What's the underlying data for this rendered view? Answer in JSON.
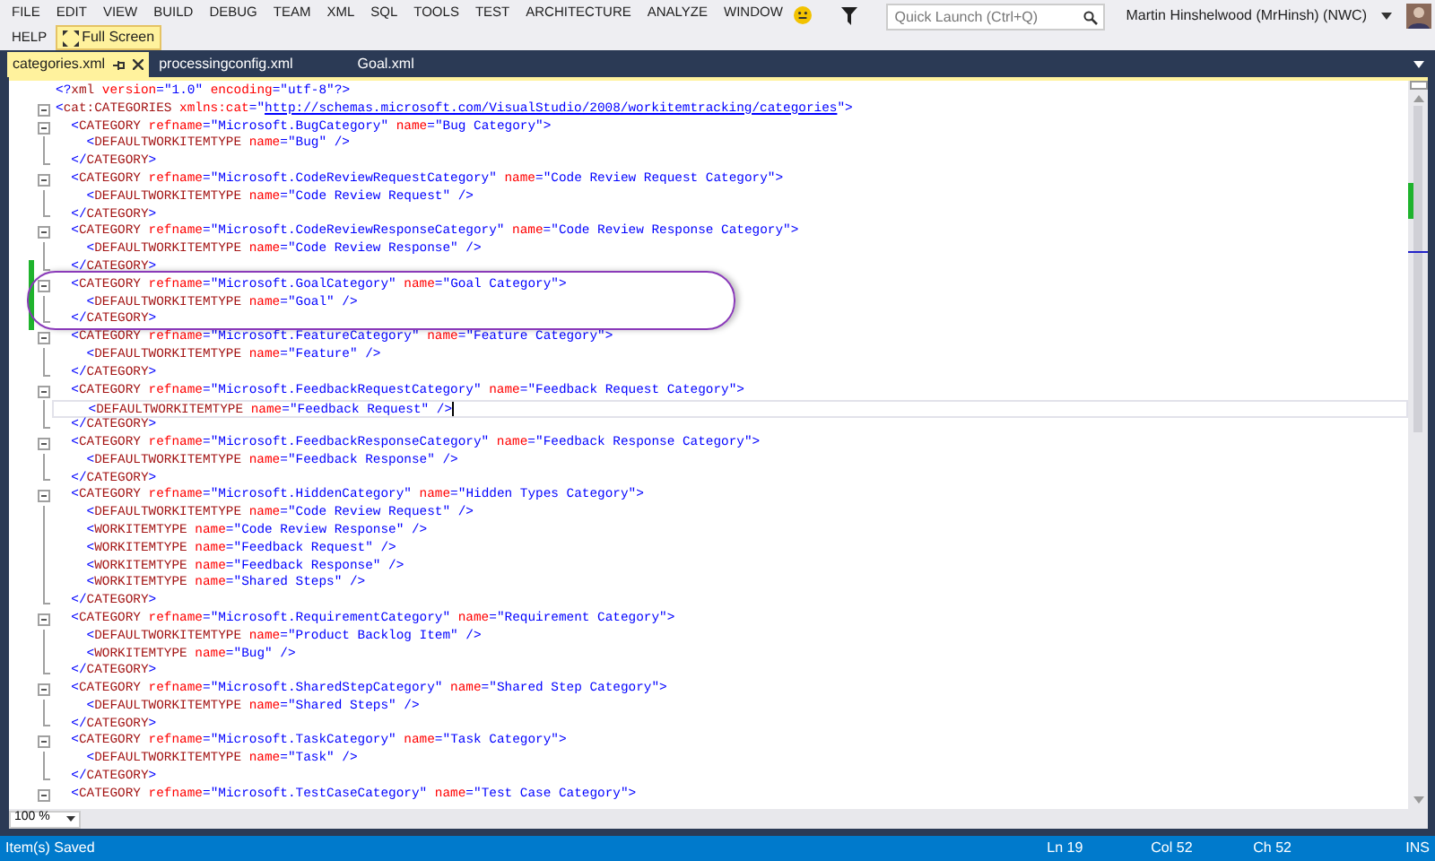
{
  "menu": [
    "FILE",
    "EDIT",
    "VIEW",
    "BUILD",
    "DEBUG",
    "TEAM",
    "XML",
    "SQL",
    "TOOLS",
    "TEST",
    "ARCHITECTURE",
    "ANALYZE",
    "WINDOW",
    "HELP"
  ],
  "full_screen": "Full Screen",
  "quick_launch": {
    "placeholder": "Quick Launch (Ctrl+Q)"
  },
  "user": "Martin Hinshelwood (MrHinsh) (NWC)",
  "tabs": [
    {
      "label": "categories.xml",
      "selected": true
    },
    {
      "label": "processingconfig.xml",
      "selected": false
    },
    {
      "label": "Goal.xml",
      "selected": false
    }
  ],
  "lines": [
    {
      "kind": "decl",
      "changed": false,
      "current": false,
      "t": [
        {
          "kind": "d",
          "text": "<?"
        },
        {
          "kind": "e",
          "text": "xml"
        },
        {
          "kind": "a",
          "text": " version"
        },
        {
          "kind": "d",
          "text": "="
        },
        {
          "kind": "v",
          "text": "\"1.0\""
        },
        {
          "kind": "a",
          "text": " encoding"
        },
        {
          "kind": "d",
          "text": "="
        },
        {
          "kind": "v",
          "text": "\"utf-8\""
        },
        {
          "kind": "d",
          "text": "?>"
        }
      ]
    },
    {
      "kind": "open",
      "changed": false,
      "current": false,
      "t": [
        {
          "kind": "d",
          "text": "<"
        },
        {
          "kind": "e",
          "text": "cat:CATEGORIES"
        },
        {
          "kind": "a",
          "text": " xmlns:cat"
        },
        {
          "kind": "d",
          "text": "="
        },
        {
          "kind": "v",
          "text": "\""
        },
        {
          "kind": "u",
          "text": "http://schemas.microsoft.com/VisualStudio/2008/workitemtracking/categories"
        },
        {
          "kind": "v",
          "text": "\""
        },
        {
          "kind": "d",
          "text": ">"
        }
      ]
    },
    {
      "kind": "open",
      "changed": false,
      "current": false,
      "t": [
        {
          "kind": "d",
          "text": "  <"
        },
        {
          "kind": "e",
          "text": "CATEGORY"
        },
        {
          "kind": "a",
          "text": " refname"
        },
        {
          "kind": "d",
          "text": "="
        },
        {
          "kind": "v",
          "text": "\"Microsoft.BugCategory\""
        },
        {
          "kind": "a",
          "text": " name"
        },
        {
          "kind": "d",
          "text": "="
        },
        {
          "kind": "v",
          "text": "\"Bug Category\""
        },
        {
          "kind": "d",
          "text": ">"
        }
      ]
    },
    {
      "kind": "child",
      "changed": false,
      "current": false,
      "t": [
        {
          "kind": "d",
          "text": "    <"
        },
        {
          "kind": "e",
          "text": "DEFAULTWORKITEMTYPE"
        },
        {
          "kind": "a",
          "text": " name"
        },
        {
          "kind": "d",
          "text": "="
        },
        {
          "kind": "v",
          "text": "\"Bug\""
        },
        {
          "kind": "d",
          "text": " />"
        }
      ]
    },
    {
      "kind": "close",
      "changed": false,
      "current": false,
      "t": [
        {
          "kind": "d",
          "text": "  </"
        },
        {
          "kind": "e",
          "text": "CATEGORY"
        },
        {
          "kind": "d",
          "text": ">"
        }
      ]
    },
    {
      "kind": "open",
      "changed": false,
      "current": false,
      "t": [
        {
          "kind": "d",
          "text": "  <"
        },
        {
          "kind": "e",
          "text": "CATEGORY"
        },
        {
          "kind": "a",
          "text": " refname"
        },
        {
          "kind": "d",
          "text": "="
        },
        {
          "kind": "v",
          "text": "\"Microsoft.CodeReviewRequestCategory\""
        },
        {
          "kind": "a",
          "text": " name"
        },
        {
          "kind": "d",
          "text": "="
        },
        {
          "kind": "v",
          "text": "\"Code Review Request Category\""
        },
        {
          "kind": "d",
          "text": ">"
        }
      ]
    },
    {
      "kind": "child",
      "changed": false,
      "current": false,
      "t": [
        {
          "kind": "d",
          "text": "    <"
        },
        {
          "kind": "e",
          "text": "DEFAULTWORKITEMTYPE"
        },
        {
          "kind": "a",
          "text": " name"
        },
        {
          "kind": "d",
          "text": "="
        },
        {
          "kind": "v",
          "text": "\"Code Review Request\""
        },
        {
          "kind": "d",
          "text": " />"
        }
      ]
    },
    {
      "kind": "close",
      "changed": false,
      "current": false,
      "t": [
        {
          "kind": "d",
          "text": "  </"
        },
        {
          "kind": "e",
          "text": "CATEGORY"
        },
        {
          "kind": "d",
          "text": ">"
        }
      ]
    },
    {
      "kind": "open",
      "changed": false,
      "current": false,
      "t": [
        {
          "kind": "d",
          "text": "  <"
        },
        {
          "kind": "e",
          "text": "CATEGORY"
        },
        {
          "kind": "a",
          "text": " refname"
        },
        {
          "kind": "d",
          "text": "="
        },
        {
          "kind": "v",
          "text": "\"Microsoft.CodeReviewResponseCategory\""
        },
        {
          "kind": "a",
          "text": " name"
        },
        {
          "kind": "d",
          "text": "="
        },
        {
          "kind": "v",
          "text": "\"Code Review Response Category\""
        },
        {
          "kind": "d",
          "text": ">"
        }
      ]
    },
    {
      "kind": "child",
      "changed": false,
      "current": false,
      "t": [
        {
          "kind": "d",
          "text": "    <"
        },
        {
          "kind": "e",
          "text": "DEFAULTWORKITEMTYPE"
        },
        {
          "kind": "a",
          "text": " name"
        },
        {
          "kind": "d",
          "text": "="
        },
        {
          "kind": "v",
          "text": "\"Code Review Response\""
        },
        {
          "kind": "d",
          "text": " />"
        }
      ]
    },
    {
      "kind": "close",
      "changed": true,
      "current": false,
      "t": [
        {
          "kind": "d",
          "text": "  </"
        },
        {
          "kind": "e",
          "text": "CATEGORY"
        },
        {
          "kind": "d",
          "text": ">"
        }
      ]
    },
    {
      "kind": "open",
      "changed": true,
      "current": false,
      "t": [
        {
          "kind": "d",
          "text": "  <"
        },
        {
          "kind": "e",
          "text": "CATEGORY"
        },
        {
          "kind": "a",
          "text": " refname"
        },
        {
          "kind": "d",
          "text": "="
        },
        {
          "kind": "v",
          "text": "\"Microsoft.GoalCategory\""
        },
        {
          "kind": "a",
          "text": " name"
        },
        {
          "kind": "d",
          "text": "="
        },
        {
          "kind": "v",
          "text": "\"Goal Category\""
        },
        {
          "kind": "d",
          "text": ">"
        }
      ]
    },
    {
      "kind": "child",
      "changed": true,
      "current": false,
      "t": [
        {
          "kind": "d",
          "text": "    <"
        },
        {
          "kind": "e",
          "text": "DEFAULTWORKITEMTYPE"
        },
        {
          "kind": "a",
          "text": " name"
        },
        {
          "kind": "d",
          "text": "="
        },
        {
          "kind": "v",
          "text": "\"Goal\""
        },
        {
          "kind": "d",
          "text": " />"
        }
      ]
    },
    {
      "kind": "close",
      "changed": true,
      "current": false,
      "t": [
        {
          "kind": "d",
          "text": "  </"
        },
        {
          "kind": "e",
          "text": "CATEGORY"
        },
        {
          "kind": "d",
          "text": ">"
        }
      ]
    },
    {
      "kind": "open",
      "changed": false,
      "current": false,
      "t": [
        {
          "kind": "d",
          "text": "  <"
        },
        {
          "kind": "e",
          "text": "CATEGORY"
        },
        {
          "kind": "a",
          "text": " refname"
        },
        {
          "kind": "d",
          "text": "="
        },
        {
          "kind": "v",
          "text": "\"Microsoft.FeatureCategory\""
        },
        {
          "kind": "a",
          "text": " name"
        },
        {
          "kind": "d",
          "text": "="
        },
        {
          "kind": "v",
          "text": "\"Feature Category\""
        },
        {
          "kind": "d",
          "text": ">"
        }
      ]
    },
    {
      "kind": "child",
      "changed": false,
      "current": false,
      "t": [
        {
          "kind": "d",
          "text": "    <"
        },
        {
          "kind": "e",
          "text": "DEFAULTWORKITEMTYPE"
        },
        {
          "kind": "a",
          "text": " name"
        },
        {
          "kind": "d",
          "text": "="
        },
        {
          "kind": "v",
          "text": "\"Feature\""
        },
        {
          "kind": "d",
          "text": " />"
        }
      ]
    },
    {
      "kind": "close",
      "changed": false,
      "current": false,
      "t": [
        {
          "kind": "d",
          "text": "  </"
        },
        {
          "kind": "e",
          "text": "CATEGORY"
        },
        {
          "kind": "d",
          "text": ">"
        }
      ]
    },
    {
      "kind": "open",
      "changed": false,
      "current": false,
      "t": [
        {
          "kind": "d",
          "text": "  <"
        },
        {
          "kind": "e",
          "text": "CATEGORY"
        },
        {
          "kind": "a",
          "text": " refname"
        },
        {
          "kind": "d",
          "text": "="
        },
        {
          "kind": "v",
          "text": "\"Microsoft.FeedbackRequestCategory\""
        },
        {
          "kind": "a",
          "text": " name"
        },
        {
          "kind": "d",
          "text": "="
        },
        {
          "kind": "v",
          "text": "\"Feedback Request Category\""
        },
        {
          "kind": "d",
          "text": ">"
        }
      ]
    },
    {
      "kind": "child",
      "changed": false,
      "current": true,
      "t": [
        {
          "kind": "d",
          "text": "    <"
        },
        {
          "kind": "e",
          "text": "DEFAULTWORKITEMTYPE"
        },
        {
          "kind": "a",
          "text": " name"
        },
        {
          "kind": "d",
          "text": "="
        },
        {
          "kind": "v",
          "text": "\"Feedback Request\""
        },
        {
          "kind": "d",
          "text": " />"
        }
      ]
    },
    {
      "kind": "close",
      "changed": false,
      "current": false,
      "t": [
        {
          "kind": "d",
          "text": "  </"
        },
        {
          "kind": "e",
          "text": "CATEGORY"
        },
        {
          "kind": "d",
          "text": ">"
        }
      ]
    },
    {
      "kind": "open",
      "changed": false,
      "current": false,
      "t": [
        {
          "kind": "d",
          "text": "  <"
        },
        {
          "kind": "e",
          "text": "CATEGORY"
        },
        {
          "kind": "a",
          "text": " refname"
        },
        {
          "kind": "d",
          "text": "="
        },
        {
          "kind": "v",
          "text": "\"Microsoft.FeedbackResponseCategory\""
        },
        {
          "kind": "a",
          "text": " name"
        },
        {
          "kind": "d",
          "text": "="
        },
        {
          "kind": "v",
          "text": "\"Feedback Response Category\""
        },
        {
          "kind": "d",
          "text": ">"
        }
      ]
    },
    {
      "kind": "child",
      "changed": false,
      "current": false,
      "t": [
        {
          "kind": "d",
          "text": "    <"
        },
        {
          "kind": "e",
          "text": "DEFAULTWORKITEMTYPE"
        },
        {
          "kind": "a",
          "text": " name"
        },
        {
          "kind": "d",
          "text": "="
        },
        {
          "kind": "v",
          "text": "\"Feedback Response\""
        },
        {
          "kind": "d",
          "text": " />"
        }
      ]
    },
    {
      "kind": "close",
      "changed": false,
      "current": false,
      "t": [
        {
          "kind": "d",
          "text": "  </"
        },
        {
          "kind": "e",
          "text": "CATEGORY"
        },
        {
          "kind": "d",
          "text": ">"
        }
      ]
    },
    {
      "kind": "open",
      "changed": false,
      "current": false,
      "t": [
        {
          "kind": "d",
          "text": "  <"
        },
        {
          "kind": "e",
          "text": "CATEGORY"
        },
        {
          "kind": "a",
          "text": " refname"
        },
        {
          "kind": "d",
          "text": "="
        },
        {
          "kind": "v",
          "text": "\"Microsoft.HiddenCategory\""
        },
        {
          "kind": "a",
          "text": " name"
        },
        {
          "kind": "d",
          "text": "="
        },
        {
          "kind": "v",
          "text": "\"Hidden Types Category\""
        },
        {
          "kind": "d",
          "text": ">"
        }
      ]
    },
    {
      "kind": "child",
      "changed": false,
      "current": false,
      "t": [
        {
          "kind": "d",
          "text": "    <"
        },
        {
          "kind": "e",
          "text": "DEFAULTWORKITEMTYPE"
        },
        {
          "kind": "a",
          "text": " name"
        },
        {
          "kind": "d",
          "text": "="
        },
        {
          "kind": "v",
          "text": "\"Code Review Request\""
        },
        {
          "kind": "d",
          "text": " />"
        }
      ]
    },
    {
      "kind": "child",
      "changed": false,
      "current": false,
      "t": [
        {
          "kind": "d",
          "text": "    <"
        },
        {
          "kind": "e",
          "text": "WORKITEMTYPE"
        },
        {
          "kind": "a",
          "text": " name"
        },
        {
          "kind": "d",
          "text": "="
        },
        {
          "kind": "v",
          "text": "\"Code Review Response\""
        },
        {
          "kind": "d",
          "text": " />"
        }
      ]
    },
    {
      "kind": "child",
      "changed": false,
      "current": false,
      "t": [
        {
          "kind": "d",
          "text": "    <"
        },
        {
          "kind": "e",
          "text": "WORKITEMTYPE"
        },
        {
          "kind": "a",
          "text": " name"
        },
        {
          "kind": "d",
          "text": "="
        },
        {
          "kind": "v",
          "text": "\"Feedback Request\""
        },
        {
          "kind": "d",
          "text": " />"
        }
      ]
    },
    {
      "kind": "child",
      "changed": false,
      "current": false,
      "t": [
        {
          "kind": "d",
          "text": "    <"
        },
        {
          "kind": "e",
          "text": "WORKITEMTYPE"
        },
        {
          "kind": "a",
          "text": " name"
        },
        {
          "kind": "d",
          "text": "="
        },
        {
          "kind": "v",
          "text": "\"Feedback Response\""
        },
        {
          "kind": "d",
          "text": " />"
        }
      ]
    },
    {
      "kind": "child",
      "changed": false,
      "current": false,
      "t": [
        {
          "kind": "d",
          "text": "    <"
        },
        {
          "kind": "e",
          "text": "WORKITEMTYPE"
        },
        {
          "kind": "a",
          "text": " name"
        },
        {
          "kind": "d",
          "text": "="
        },
        {
          "kind": "v",
          "text": "\"Shared Steps\""
        },
        {
          "kind": "d",
          "text": " />"
        }
      ]
    },
    {
      "kind": "close",
      "changed": false,
      "current": false,
      "t": [
        {
          "kind": "d",
          "text": "  </"
        },
        {
          "kind": "e",
          "text": "CATEGORY"
        },
        {
          "kind": "d",
          "text": ">"
        }
      ]
    },
    {
      "kind": "open",
      "changed": false,
      "current": false,
      "t": [
        {
          "kind": "d",
          "text": "  <"
        },
        {
          "kind": "e",
          "text": "CATEGORY"
        },
        {
          "kind": "a",
          "text": " refname"
        },
        {
          "kind": "d",
          "text": "="
        },
        {
          "kind": "v",
          "text": "\"Microsoft.RequirementCategory\""
        },
        {
          "kind": "a",
          "text": " name"
        },
        {
          "kind": "d",
          "text": "="
        },
        {
          "kind": "v",
          "text": "\"Requirement Category\""
        },
        {
          "kind": "d",
          "text": ">"
        }
      ]
    },
    {
      "kind": "child",
      "changed": false,
      "current": false,
      "t": [
        {
          "kind": "d",
          "text": "    <"
        },
        {
          "kind": "e",
          "text": "DEFAULTWORKITEMTYPE"
        },
        {
          "kind": "a",
          "text": " name"
        },
        {
          "kind": "d",
          "text": "="
        },
        {
          "kind": "v",
          "text": "\"Product Backlog Item\""
        },
        {
          "kind": "d",
          "text": " />"
        }
      ]
    },
    {
      "kind": "child",
      "changed": false,
      "current": false,
      "t": [
        {
          "kind": "d",
          "text": "    <"
        },
        {
          "kind": "e",
          "text": "WORKITEMTYPE"
        },
        {
          "kind": "a",
          "text": " name"
        },
        {
          "kind": "d",
          "text": "="
        },
        {
          "kind": "v",
          "text": "\"Bug\""
        },
        {
          "kind": "d",
          "text": " />"
        }
      ]
    },
    {
      "kind": "close",
      "changed": false,
      "current": false,
      "t": [
        {
          "kind": "d",
          "text": "  </"
        },
        {
          "kind": "e",
          "text": "CATEGORY"
        },
        {
          "kind": "d",
          "text": ">"
        }
      ]
    },
    {
      "kind": "open",
      "changed": false,
      "current": false,
      "t": [
        {
          "kind": "d",
          "text": "  <"
        },
        {
          "kind": "e",
          "text": "CATEGORY"
        },
        {
          "kind": "a",
          "text": " refname"
        },
        {
          "kind": "d",
          "text": "="
        },
        {
          "kind": "v",
          "text": "\"Microsoft.SharedStepCategory\""
        },
        {
          "kind": "a",
          "text": " name"
        },
        {
          "kind": "d",
          "text": "="
        },
        {
          "kind": "v",
          "text": "\"Shared Step Category\""
        },
        {
          "kind": "d",
          "text": ">"
        }
      ]
    },
    {
      "kind": "child",
      "changed": false,
      "current": false,
      "t": [
        {
          "kind": "d",
          "text": "    <"
        },
        {
          "kind": "e",
          "text": "DEFAULTWORKITEMTYPE"
        },
        {
          "kind": "a",
          "text": " name"
        },
        {
          "kind": "d",
          "text": "="
        },
        {
          "kind": "v",
          "text": "\"Shared Steps\""
        },
        {
          "kind": "d",
          "text": " />"
        }
      ]
    },
    {
      "kind": "close",
      "changed": false,
      "current": false,
      "t": [
        {
          "kind": "d",
          "text": "  </"
        },
        {
          "kind": "e",
          "text": "CATEGORY"
        },
        {
          "kind": "d",
          "text": ">"
        }
      ]
    },
    {
      "kind": "open",
      "changed": false,
      "current": false,
      "t": [
        {
          "kind": "d",
          "text": "  <"
        },
        {
          "kind": "e",
          "text": "CATEGORY"
        },
        {
          "kind": "a",
          "text": " refname"
        },
        {
          "kind": "d",
          "text": "="
        },
        {
          "kind": "v",
          "text": "\"Microsoft.TaskCategory\""
        },
        {
          "kind": "a",
          "text": " name"
        },
        {
          "kind": "d",
          "text": "="
        },
        {
          "kind": "v",
          "text": "\"Task Category\""
        },
        {
          "kind": "d",
          "text": ">"
        }
      ]
    },
    {
      "kind": "child",
      "changed": false,
      "current": false,
      "t": [
        {
          "kind": "d",
          "text": "    <"
        },
        {
          "kind": "e",
          "text": "DEFAULTWORKITEMTYPE"
        },
        {
          "kind": "a",
          "text": " name"
        },
        {
          "kind": "d",
          "text": "="
        },
        {
          "kind": "v",
          "text": "\"Task\""
        },
        {
          "kind": "d",
          "text": " />"
        }
      ]
    },
    {
      "kind": "close",
      "changed": false,
      "current": false,
      "t": [
        {
          "kind": "d",
          "text": "  </"
        },
        {
          "kind": "e",
          "text": "CATEGORY"
        },
        {
          "kind": "d",
          "text": ">"
        }
      ]
    },
    {
      "kind": "open",
      "changed": false,
      "current": false,
      "t": [
        {
          "kind": "d",
          "text": "  <"
        },
        {
          "kind": "e",
          "text": "CATEGORY"
        },
        {
          "kind": "a",
          "text": " refname"
        },
        {
          "kind": "d",
          "text": "="
        },
        {
          "kind": "v",
          "text": "\"Microsoft.TestCaseCategory\""
        },
        {
          "kind": "a",
          "text": " name"
        },
        {
          "kind": "d",
          "text": "="
        },
        {
          "kind": "v",
          "text": "\"Test Case Category\""
        },
        {
          "kind": "d",
          "text": ">"
        }
      ]
    }
  ],
  "zoom": "100 %",
  "status_bar": {
    "message": "Item(s) Saved",
    "line": "Ln 19",
    "column": "Col 52",
    "char": "Ch 52",
    "mode": "INS"
  }
}
